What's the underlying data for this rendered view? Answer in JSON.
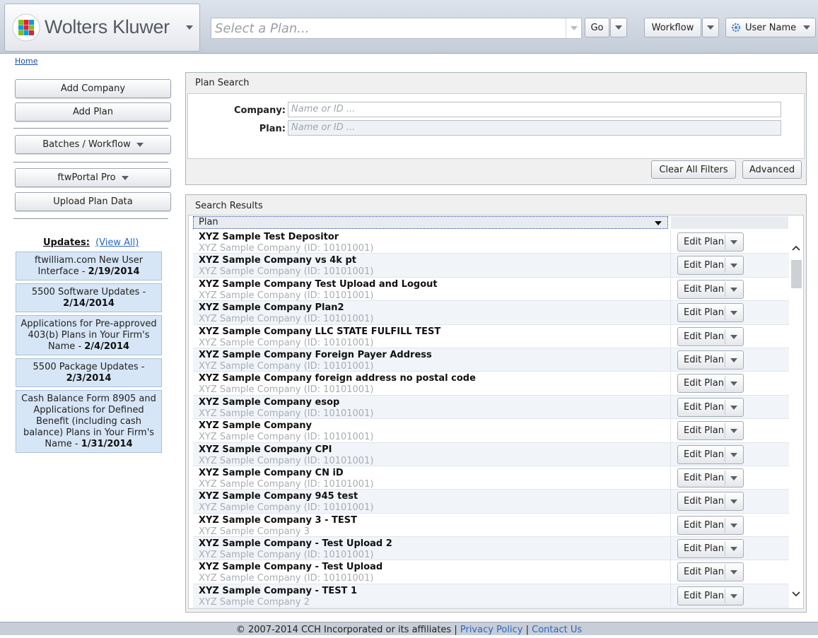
{
  "header": {
    "logo_text": "Wolters Kluwer",
    "plan_select_placeholder": "Select a Plan...",
    "go_label": "Go",
    "workflow_label": "Workflow",
    "user_label": "User Name"
  },
  "breadcrumb": {
    "home": "Home"
  },
  "sidebar": {
    "add_company": "Add Company",
    "add_plan": "Add Plan",
    "batches": "Batches / Workflow",
    "portal": "ftwPortal Pro",
    "upload": "Upload Plan Data",
    "updates_label": "Updates:",
    "view_all": "(View All)",
    "updates": [
      {
        "text": "ftwilliam.com New User Interface - ",
        "date": "2/19/2014"
      },
      {
        "text": "5500 Software Updates - ",
        "date": "2/14/2014"
      },
      {
        "text": "Applications for Pre-approved 403(b) Plans in Your Firm's Name - ",
        "date": "2/4/2014"
      },
      {
        "text": "5500 Package Updates - ",
        "date": "2/3/2014"
      },
      {
        "text": "Cash Balance Form 8905 and Applications for Defined Benefit (including cash balance) Plans in Your Firm's Name - ",
        "date": "1/31/2014"
      }
    ]
  },
  "plan_search": {
    "title": "Plan Search",
    "company_label": "Company:",
    "company_placeholder": "Name or ID ...",
    "plan_label": "Plan:",
    "plan_placeholder": "Name or ID ...",
    "clear_filters": "Clear All Filters",
    "advanced": "Advanced"
  },
  "results": {
    "title": "Search Results",
    "column_header": "Plan",
    "edit_label": "Edit Plan",
    "rows": [
      {
        "name": "XYZ Sample Test Depositor",
        "company": "XYZ Sample Company (ID: 10101001)"
      },
      {
        "name": "XYZ Sample Company vs 4k pt",
        "company": "XYZ Sample Company (ID: 10101001)"
      },
      {
        "name": "XYZ Sample Company Test Upload and Logout",
        "company": "XYZ Sample Company (ID: 10101001)"
      },
      {
        "name": "XYZ Sample Company Plan2",
        "company": "XYZ Sample Company (ID: 10101001)"
      },
      {
        "name": "XYZ Sample Company LLC STATE FULFILL TEST",
        "company": "XYZ Sample Company (ID: 10101001)"
      },
      {
        "name": "XYZ Sample Company Foreign Payer Address",
        "company": "XYZ Sample Company (ID: 10101001)"
      },
      {
        "name": "XYZ Sample Company foreign address no postal code",
        "company": "XYZ Sample Company (ID: 10101001)"
      },
      {
        "name": "XYZ Sample Company esop",
        "company": "XYZ Sample Company (ID: 10101001)"
      },
      {
        "name": "XYZ Sample Company",
        "company": "XYZ Sample Company (ID: 10101001)"
      },
      {
        "name": "XYZ Sample Company CPI",
        "company": "XYZ Sample Company (ID: 10101001)"
      },
      {
        "name": "XYZ Sample Company CN iD",
        "company": "XYZ Sample Company (ID: 10101001)"
      },
      {
        "name": "XYZ Sample Company 945 test",
        "company": "XYZ Sample Company (ID: 10101001)"
      },
      {
        "name": "XYZ Sample Company 3 - TEST",
        "company": "XYZ Sample Company 3"
      },
      {
        "name": "XYZ Sample Company - Test Upload 2",
        "company": "XYZ Sample Company (ID: 10101001)"
      },
      {
        "name": "XYZ Sample Company - Test Upload",
        "company": "XYZ Sample Company (ID: 10101001)"
      },
      {
        "name": "XYZ Sample Company - TEST 1",
        "company": "XYZ Sample Company 2"
      }
    ]
  },
  "footer": {
    "copyright": "© 2007-2014 CCH Incorporated or its affiliates",
    "sep": "|",
    "privacy": "Privacy Policy",
    "contact": "Contact Us"
  },
  "colors": {
    "header_bg": "#c3ccd8",
    "card_bg": "#d7e6f6",
    "link": "#2b66c4"
  }
}
